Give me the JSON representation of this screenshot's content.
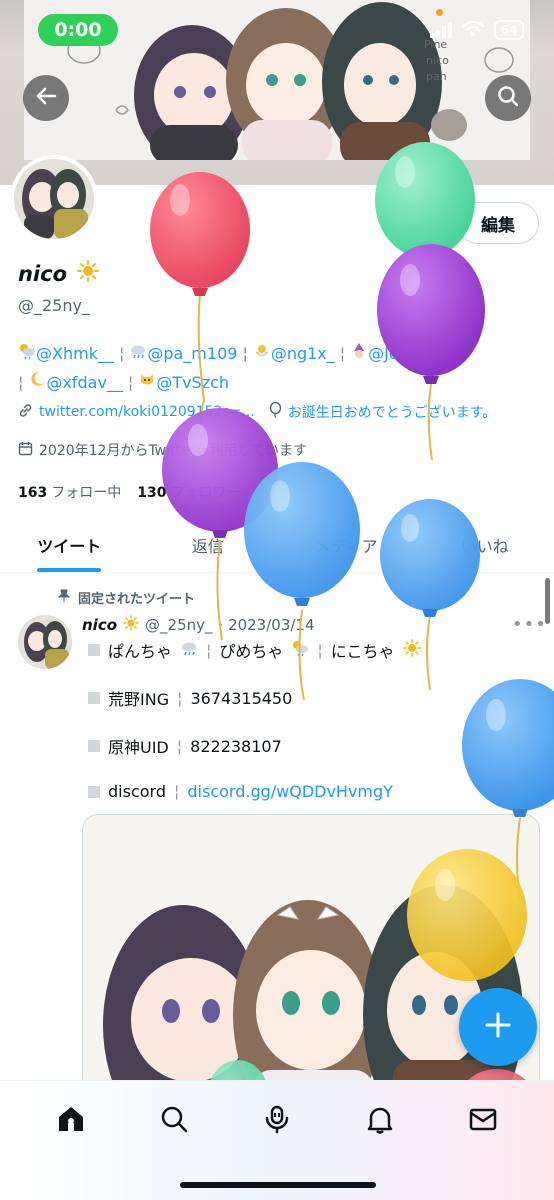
{
  "status_bar": {
    "time": "0:00",
    "battery": "64"
  },
  "banner": {
    "back_icon": "back-arrow-icon",
    "search_icon": "search-icon",
    "art_text": [
      "Pine",
      "nico",
      "pan"
    ]
  },
  "profile": {
    "edit_label": "編集",
    "display_name": "nico",
    "handle": "@_25ny_",
    "bio_row1": [
      "@Xhmk__",
      "@pa_m109",
      "@ng1x_",
      "@Jona_1226"
    ],
    "bio_row2": [
      "@xfdav__",
      "@TvSzch"
    ],
    "link": "twitter.com/koki01209152s=...",
    "birthday": "お誕生日おめでとうございます。",
    "joined": "2020年12月からTwitterを利用しています",
    "following_count": "163",
    "following_label": "フォロー中",
    "followers_count": "130",
    "followers_label": "フォロワー"
  },
  "tabs": [
    {
      "label": "ツイート",
      "active": true
    },
    {
      "label": "返信",
      "active": false
    },
    {
      "label": "メディア",
      "active": false
    },
    {
      "label": "いいね",
      "active": false
    }
  ],
  "tweet": {
    "pinned_label": "固定されたツイート",
    "name": "nico",
    "handle": "@_25ny_",
    "date": "· 2023/03/14",
    "line1": [
      "ぱんちゃ",
      "ぴめちゃ",
      "にこちゃ"
    ],
    "line2": [
      "荒野ING",
      "3674315450"
    ],
    "line3": [
      "原神UID",
      "822238107"
    ],
    "line4_label": "discord",
    "line4_link": "discord.gg/wQDDvHvmgY",
    "separator": "¦"
  },
  "colors": {
    "accent": "#1d9bf0",
    "status_green": "#30d158",
    "balloon_red": "#e8475f",
    "balloon_green": "#53dca4",
    "balloon_purple": "#9b3fd0",
    "balloon_blue": "#4aa2ef",
    "balloon_yellow": "#f3c935"
  }
}
